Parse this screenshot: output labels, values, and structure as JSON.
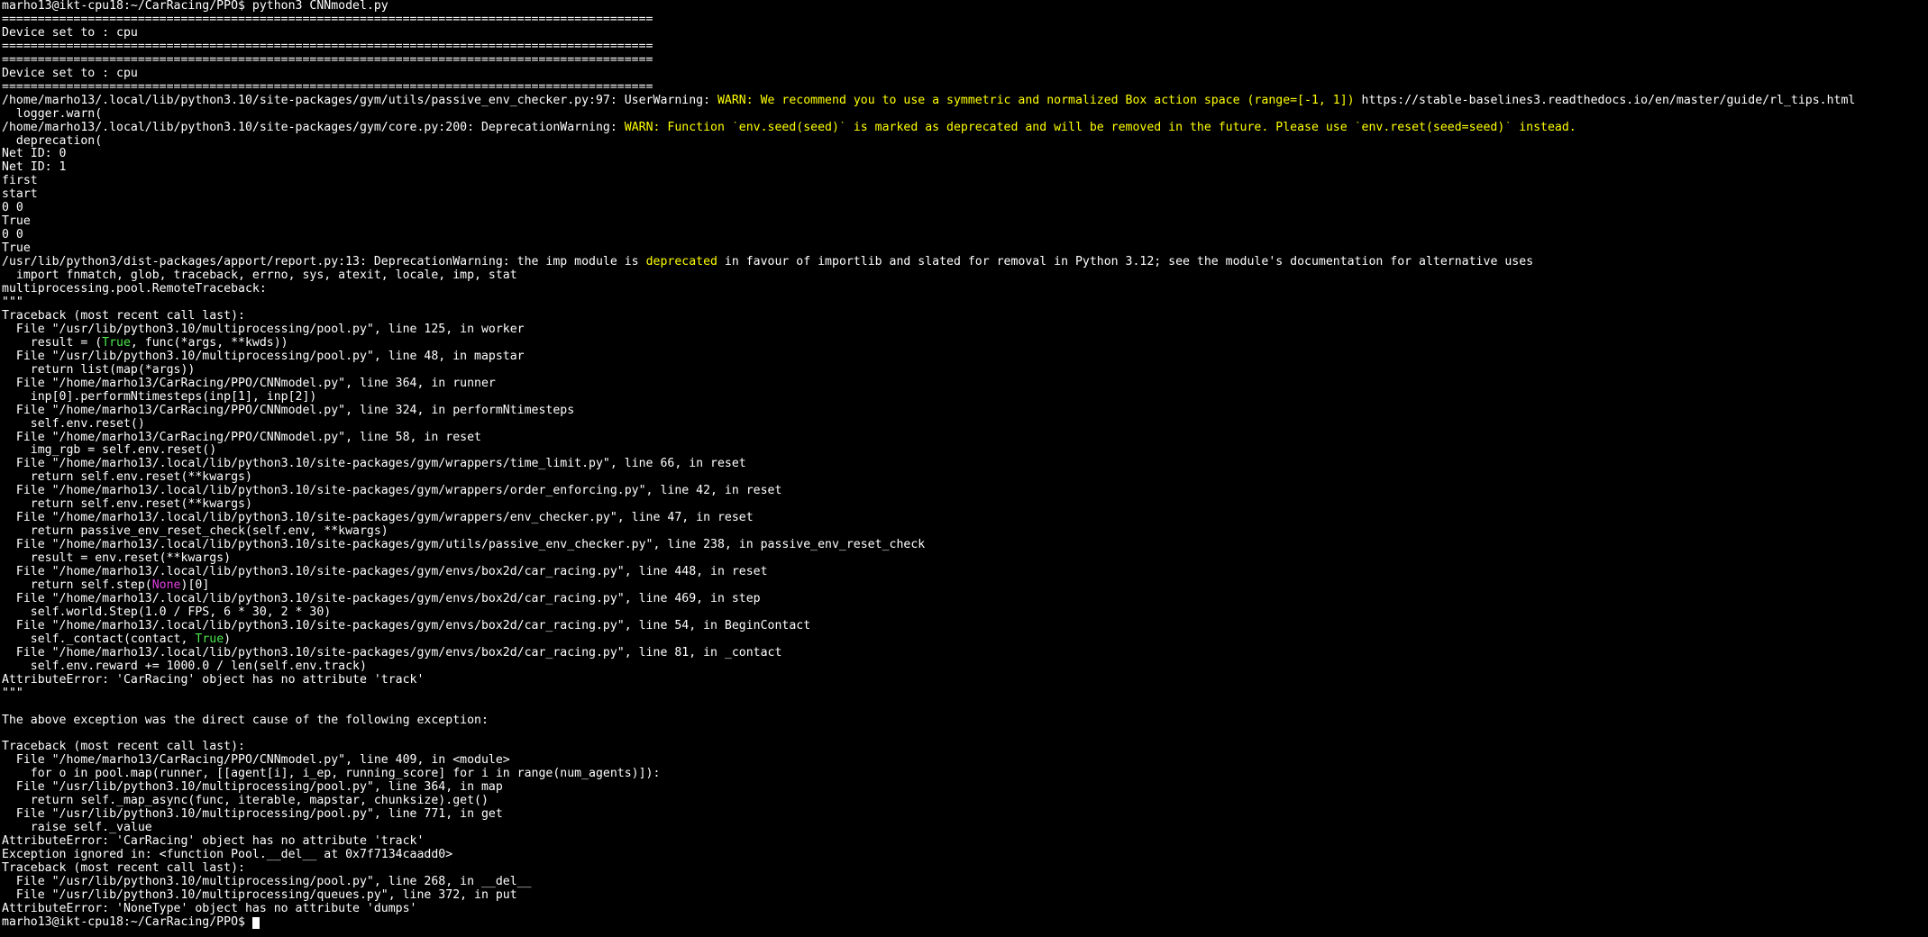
{
  "terminal": {
    "colors": {
      "background": "#000000",
      "foreground": "#ffffff",
      "warn_yellow": "#ffff00",
      "keyword_green": "#4ce64c",
      "keyword_magenta": "#e040e0"
    },
    "lines": [
      [
        {
          "t": "marho13@ikt-cpu18:~/CarRacing/PPO$ python3 CNNmodel.py"
        }
      ],
      [
        {
          "t": "==========================================================================================="
        }
      ],
      [
        {
          "t": "Device set to : cpu"
        }
      ],
      [
        {
          "t": "==========================================================================================="
        }
      ],
      [
        {
          "t": "==========================================================================================="
        }
      ],
      [
        {
          "t": "Device set to : cpu"
        }
      ],
      [
        {
          "t": "==========================================================================================="
        }
      ],
      [
        {
          "t": "/home/marho13/.local/lib/python3.10/site-packages/gym/utils/passive_env_checker.py:97: UserWarning: "
        },
        {
          "t": "WARN: We recommend you to use a symmetric and normalized Box action space (range=[-1, 1])",
          "c": "warn_yellow"
        },
        {
          "t": " https://stable-baselines3.readthedocs.io/en/master/guide/rl_tips.html"
        }
      ],
      [
        {
          "t": "  logger.warn("
        }
      ],
      [
        {
          "t": "/home/marho13/.local/lib/python3.10/site-packages/gym/core.py:200: DeprecationWarning: "
        },
        {
          "t": "WARN: Function `env.seed(seed)` is marked as deprecated and will be removed in the future. Please use `env.reset(seed=seed)` instead.",
          "c": "warn_yellow"
        }
      ],
      [
        {
          "t": "  deprecation("
        }
      ],
      [
        {
          "t": "Net ID: 0"
        }
      ],
      [
        {
          "t": "Net ID: 1"
        }
      ],
      [
        {
          "t": "first"
        }
      ],
      [
        {
          "t": "start"
        }
      ],
      [
        {
          "t": "0 0"
        }
      ],
      [
        {
          "t": "True"
        }
      ],
      [
        {
          "t": "0 0"
        }
      ],
      [
        {
          "t": "True"
        }
      ],
      [
        {
          "t": "/usr/lib/python3/dist-packages/apport/report.py:13: DeprecationWarning: the imp module is "
        },
        {
          "t": "deprecated",
          "c": "warn_yellow"
        },
        {
          "t": " in favour of importlib and slated for removal in Python 3.12; see the module's documentation for alternative uses"
        }
      ],
      [
        {
          "t": "  import fnmatch, glob, traceback, errno, sys, atexit, locale, imp, stat"
        }
      ],
      [
        {
          "t": "multiprocessing.pool.RemoteTraceback:"
        }
      ],
      [
        {
          "t": "\"\"\""
        }
      ],
      [
        {
          "t": "Traceback (most recent call last):"
        }
      ],
      [
        {
          "t": "  File \"/usr/lib/python3.10/multiprocessing/pool.py\", line 125, in worker"
        }
      ],
      [
        {
          "t": "    result = ("
        },
        {
          "t": "True",
          "c": "keyword_green"
        },
        {
          "t": ", func(*args, **kwds))"
        }
      ],
      [
        {
          "t": "  File \"/usr/lib/python3.10/multiprocessing/pool.py\", line 48, in mapstar"
        }
      ],
      [
        {
          "t": "    return list(map(*args))"
        }
      ],
      [
        {
          "t": "  File \"/home/marho13/CarRacing/PPO/CNNmodel.py\", line 364, in runner"
        }
      ],
      [
        {
          "t": "    inp[0].performNtimesteps(inp[1], inp[2])"
        }
      ],
      [
        {
          "t": "  File \"/home/marho13/CarRacing/PPO/CNNmodel.py\", line 324, in performNtimesteps"
        }
      ],
      [
        {
          "t": "    self.env.reset()"
        }
      ],
      [
        {
          "t": "  File \"/home/marho13/CarRacing/PPO/CNNmodel.py\", line 58, in reset"
        }
      ],
      [
        {
          "t": "    img_rgb = self.env.reset()"
        }
      ],
      [
        {
          "t": "  File \"/home/marho13/.local/lib/python3.10/site-packages/gym/wrappers/time_limit.py\", line 66, in reset"
        }
      ],
      [
        {
          "t": "    return self.env.reset(**kwargs)"
        }
      ],
      [
        {
          "t": "  File \"/home/marho13/.local/lib/python3.10/site-packages/gym/wrappers/order_enforcing.py\", line 42, in reset"
        }
      ],
      [
        {
          "t": "    return self.env.reset(**kwargs)"
        }
      ],
      [
        {
          "t": "  File \"/home/marho13/.local/lib/python3.10/site-packages/gym/wrappers/env_checker.py\", line 47, in reset"
        }
      ],
      [
        {
          "t": "    return passive_env_reset_check(self.env, **kwargs)"
        }
      ],
      [
        {
          "t": "  File \"/home/marho13/.local/lib/python3.10/site-packages/gym/utils/passive_env_checker.py\", line 238, in passive_env_reset_check"
        }
      ],
      [
        {
          "t": "    result = env.reset(**kwargs)"
        }
      ],
      [
        {
          "t": "  File \"/home/marho13/.local/lib/python3.10/site-packages/gym/envs/box2d/car_racing.py\", line 448, in reset"
        }
      ],
      [
        {
          "t": "    return self.step("
        },
        {
          "t": "None",
          "c": "keyword_magenta"
        },
        {
          "t": ")[0]"
        }
      ],
      [
        {
          "t": "  File \"/home/marho13/.local/lib/python3.10/site-packages/gym/envs/box2d/car_racing.py\", line 469, in step"
        }
      ],
      [
        {
          "t": "    self.world.Step(1.0 / FPS, 6 * 30, 2 * 30)"
        }
      ],
      [
        {
          "t": "  File \"/home/marho13/.local/lib/python3.10/site-packages/gym/envs/box2d/car_racing.py\", line 54, in BeginContact"
        }
      ],
      [
        {
          "t": "    self._contact(contact, "
        },
        {
          "t": "True",
          "c": "keyword_green"
        },
        {
          "t": ")"
        }
      ],
      [
        {
          "t": "  File \"/home/marho13/.local/lib/python3.10/site-packages/gym/envs/box2d/car_racing.py\", line 81, in _contact"
        }
      ],
      [
        {
          "t": "    self.env.reward += 1000.0 / len(self.env.track)"
        }
      ],
      [
        {
          "t": "AttributeError: 'CarRacing' object has no attribute 'track'"
        }
      ],
      [
        {
          "t": "\"\"\""
        }
      ],
      [
        {
          "t": ""
        }
      ],
      [
        {
          "t": "The above exception was the direct cause of the following exception:"
        }
      ],
      [
        {
          "t": ""
        }
      ],
      [
        {
          "t": "Traceback (most recent call last):"
        }
      ],
      [
        {
          "t": "  File \"/home/marho13/CarRacing/PPO/CNNmodel.py\", line 409, in <module>"
        }
      ],
      [
        {
          "t": "    for o in pool.map(runner, [[agent[i], i_ep, running_score] for i in range(num_agents)]):"
        }
      ],
      [
        {
          "t": "  File \"/usr/lib/python3.10/multiprocessing/pool.py\", line 364, in map"
        }
      ],
      [
        {
          "t": "    return self._map_async(func, iterable, mapstar, chunksize).get()"
        }
      ],
      [
        {
          "t": "  File \"/usr/lib/python3.10/multiprocessing/pool.py\", line 771, in get"
        }
      ],
      [
        {
          "t": "    raise self._value"
        }
      ],
      [
        {
          "t": "AttributeError: 'CarRacing' object has no attribute 'track'"
        }
      ],
      [
        {
          "t": "Exception ignored in: <function Pool.__del__ at 0x7f7134caadd0>"
        }
      ],
      [
        {
          "t": "Traceback (most recent call last):"
        }
      ],
      [
        {
          "t": "  File \"/usr/lib/python3.10/multiprocessing/pool.py\", line 268, in __del__"
        }
      ],
      [
        {
          "t": "  File \"/usr/lib/python3.10/multiprocessing/queues.py\", line 372, in put"
        }
      ],
      [
        {
          "t": "AttributeError: 'NoneType' object has no attribute 'dumps'"
        }
      ]
    ],
    "prompt": "marho13@ikt-cpu18:~/CarRacing/PPO$ "
  }
}
